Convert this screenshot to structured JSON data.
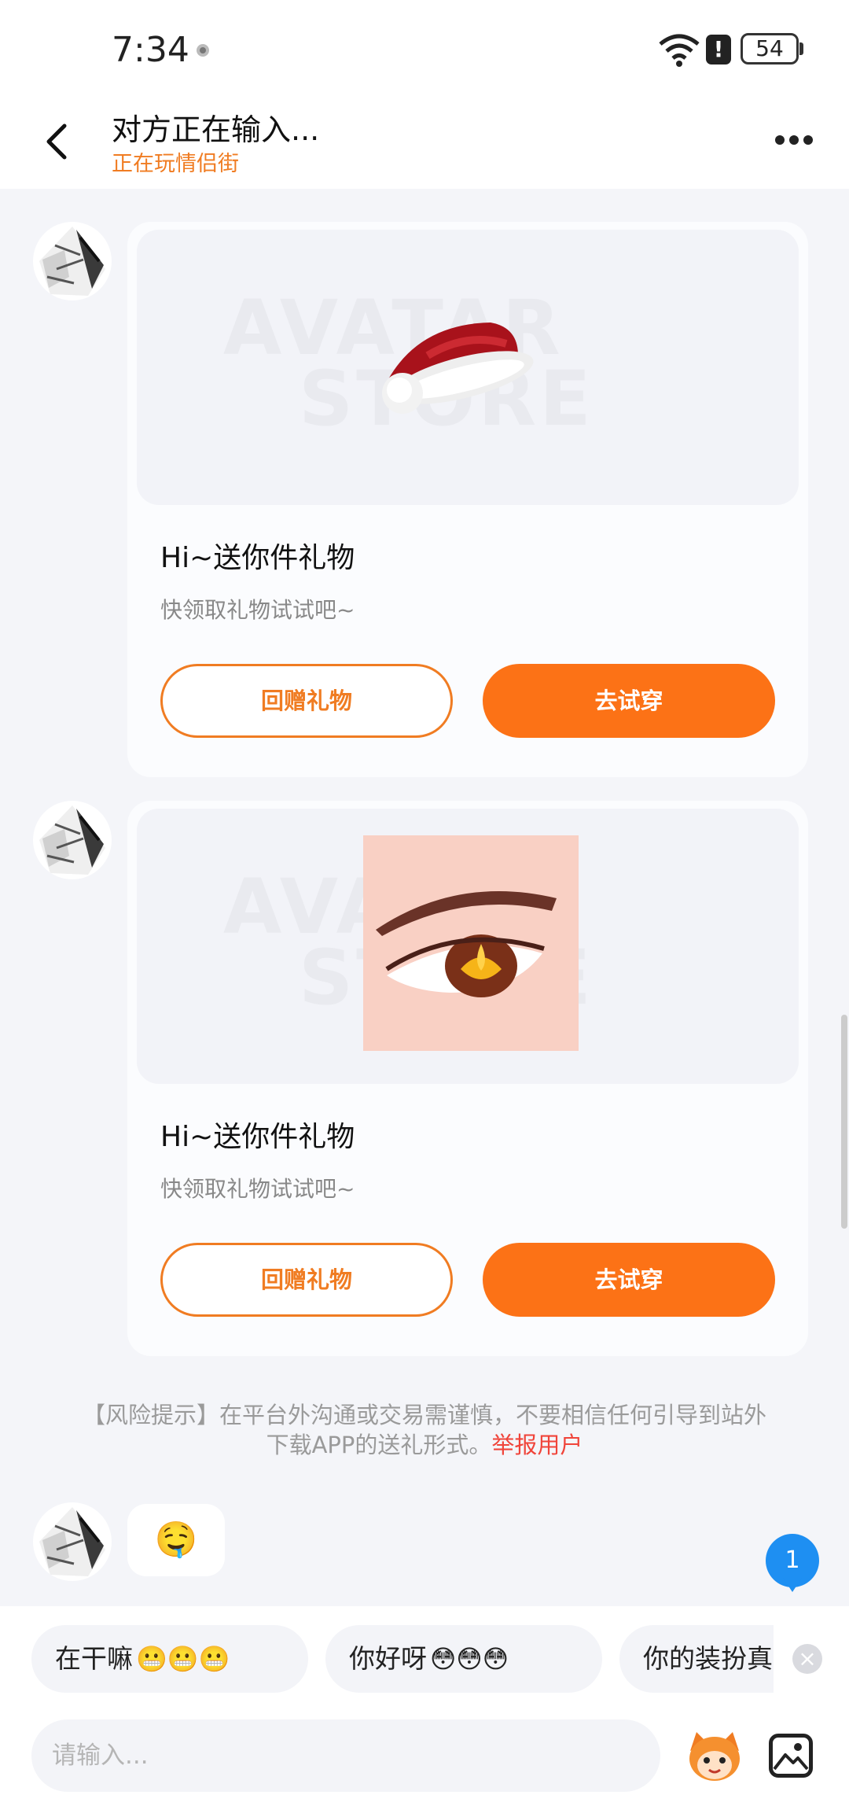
{
  "status_bar": {
    "time": "7:34",
    "battery": "54"
  },
  "header": {
    "title": "对方正在输入...",
    "subtitle": "正在玩情侣街"
  },
  "gift_cards": [
    {
      "title": "Hi~送你件礼物",
      "desc": "快领取礼物试试吧~",
      "btn_return": "回赠礼物",
      "btn_try": "去试穿",
      "item": "santa-hat"
    },
    {
      "title": "Hi~送你件礼物",
      "desc": "快领取礼物试试吧~",
      "btn_return": "回赠礼物",
      "btn_try": "去试穿",
      "item": "anime-eye"
    }
  ],
  "watermark": {
    "line1": "AVATAR",
    "line2": "STORE"
  },
  "risk_notice": {
    "text": "【风险提示】在平台外沟通或交易需谨慎，不要相信任何引导到站外下载APP的送礼形式。",
    "link": "举报用户"
  },
  "last_message": {
    "emoji": "🤤"
  },
  "unread_badge": "1",
  "quick_replies": [
    {
      "label": "在干嘛",
      "emoji": "😬😬😬"
    },
    {
      "label": "你好呀",
      "emoji": "😳😳😳"
    },
    {
      "label": "你的装扮真"
    }
  ],
  "input": {
    "placeholder": "请输入..."
  },
  "colors": {
    "accent": "#fc7216",
    "badge": "#1e8ff2",
    "link_red": "#f0443a"
  }
}
